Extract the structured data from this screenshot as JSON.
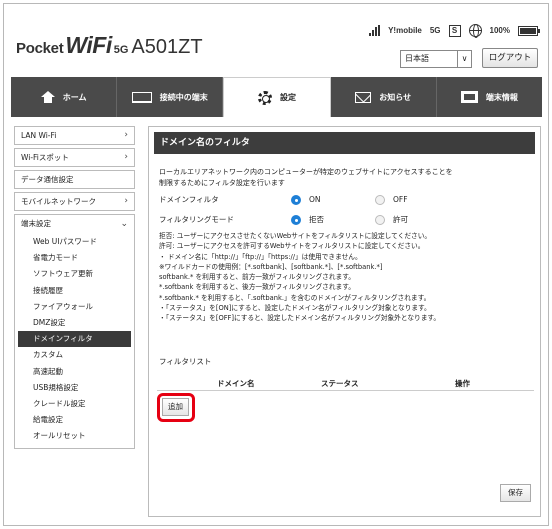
{
  "header": {
    "logo_pocket": "Pocket",
    "logo_wifi": "WiFi",
    "logo_5g": "5G",
    "logo_model": "A501ZT",
    "carrier": "Y!mobile",
    "network": "5G",
    "sim": "S",
    "battery": "100%",
    "language": "日本語",
    "logout_label": "ログアウト"
  },
  "nav": {
    "tabs": [
      {
        "label": "ホーム",
        "icon": "home-icon"
      },
      {
        "label": "接続中の端末",
        "icon": "devices-icon"
      },
      {
        "label": "設定",
        "icon": "gear-icon"
      },
      {
        "label": "お知らせ",
        "icon": "mail-icon"
      },
      {
        "label": "端末情報",
        "icon": "device-info-icon"
      }
    ],
    "active_tab": "設定"
  },
  "sidebar": {
    "items": [
      {
        "label": "LAN Wi-Fi",
        "chevron": "›"
      },
      {
        "label": "Wi-Fiスポット",
        "chevron": "›"
      },
      {
        "label": "データ通信設定",
        "chevron": ""
      },
      {
        "label": "モバイルネットワーク",
        "chevron": "›"
      }
    ],
    "group": {
      "label": "端末設定",
      "chevron": "⌄",
      "subitems": [
        "Web UIパスワード",
        "省電力モード",
        "ソフトウェア更新",
        "接続履歴",
        "ファイアウォール",
        "DMZ設定",
        "ドメインフィルタ",
        "カスタム",
        "高速起動",
        "USB規格設定",
        "クレードル設定",
        "給電設定",
        "オールリセット"
      ],
      "active": "ドメインフィルタ"
    }
  },
  "main": {
    "title": "ドメイン名のフィルタ",
    "description": [
      "ローカルエリアネットワーク内のコンピューターが特定のウェブサイトにアクセスすることを",
      "制限するためにフィルタ設定を行います"
    ],
    "domain_filter": {
      "label": "ドメインフィルタ",
      "on": "ON",
      "off": "OFF",
      "selected": "ON"
    },
    "filtering_mode": {
      "label": "フィルタリングモード",
      "deny": "拒否",
      "allow": "許可",
      "selected": "拒否"
    },
    "notes": [
      "拒否: ユーザーにアクセスさせたくないWebサイトをフィルタリストに設定してください。",
      "許可: ユーザーにアクセスを許可するWebサイトをフィルタリストに設定してください。",
      "・ ドメイン名に「http://」「ftp://」「https://」は使用できません。",
      "   ※ワイルドカードの使用例：[*.softbank]、[softbank.*]、[*.softbank.*]",
      "      softbank.* を利用すると、前方一致がフィルタリングされます。",
      "      *.softbank を利用すると、後方一致がフィルタリングされます。",
      "      *.softbank.* を利用すると、「.softbank.」を含むのドメインがフィルタリングされます。",
      "・「ステータス」を[ON]にすると、設定したドメイン名がフィルタリング対象となります。",
      "・「ステータス」を[OFF]にすると、設定したドメイン名がフィルタリング対象外となります。"
    ],
    "filter_list": {
      "title": "フィルタリスト",
      "columns": [
        "ドメイン名",
        "ステータス",
        "操作"
      ],
      "rows": [],
      "add_label": "追加"
    },
    "save_label": "保存",
    "colors": {
      "accent_radio": "#1e7fd6",
      "highlight": "#e60012",
      "nav_bg": "#4a4a4a"
    }
  }
}
